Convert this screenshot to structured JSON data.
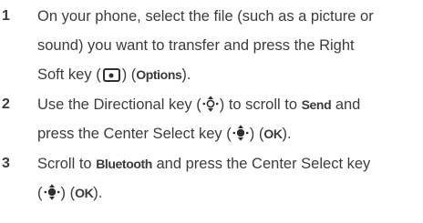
{
  "steps": [
    {
      "number": "1",
      "lines": [
        [
          "On your phone, select the file (such as a picture or"
        ],
        [
          "sound) you want to transfer and press the Right"
        ],
        [
          "Soft key (",
          "",
          ") (",
          "Options",
          ")."
        ]
      ]
    },
    {
      "number": "2",
      "line1": {
        "a": "Use the Directional key (",
        "b": ") to scroll to ",
        "send": "Send",
        "c": " and"
      },
      "line2": {
        "a": "press the Center Select key (",
        "b": ") (",
        "ok": "OK",
        "c": ")."
      }
    },
    {
      "number": "3",
      "line1": {
        "a": "Scroll to ",
        "bluetooth": "Bluetooth",
        "b": " and press the Center Select key"
      },
      "line2": {
        "a": "(",
        "b": ") (",
        "ok": "OK",
        "c": ")."
      }
    }
  ],
  "icons": {
    "right_soft_key": "right-soft-key-icon",
    "directional_key": "directional-key-icon",
    "center_select_key": "center-select-key-icon"
  },
  "colors": {
    "text": "#3c3c3c",
    "icon": "#2f2f2f",
    "background": "#ffffff"
  }
}
